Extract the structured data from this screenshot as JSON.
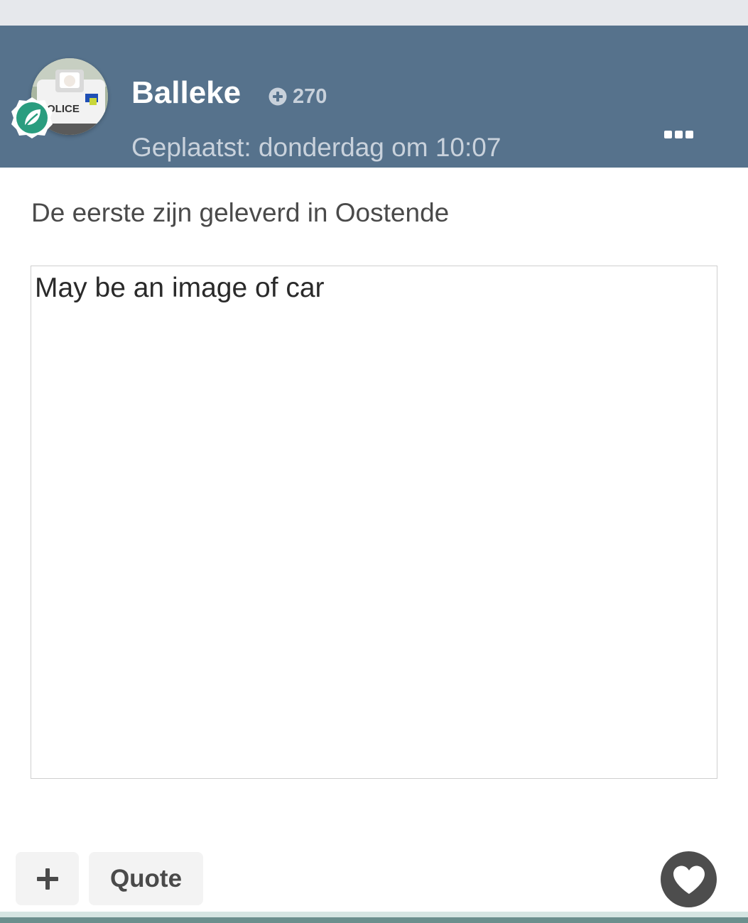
{
  "post": {
    "author": {
      "username": "Balleke",
      "reputation": "270",
      "avatar_text": "POLICE"
    },
    "timestamp": "Geplaatst: donderdag om 10:07",
    "body_text": "De eerste zijn geleverd in Oostende",
    "image_alt": "May be an image of car"
  },
  "actions": {
    "quote_label": "Quote"
  },
  "icons": {
    "avatar": "avatar-image",
    "rank": "leaf-badge-icon",
    "reputation": "plus-circle-icon",
    "more": "ellipsis-icon",
    "multiquote": "plus-icon",
    "like": "heart-icon"
  },
  "colors": {
    "header_bg": "#56728c",
    "badge_green": "#2a9d7f",
    "like_button": "#4d4d4d",
    "bottom_accent": "#6b8f8d"
  }
}
